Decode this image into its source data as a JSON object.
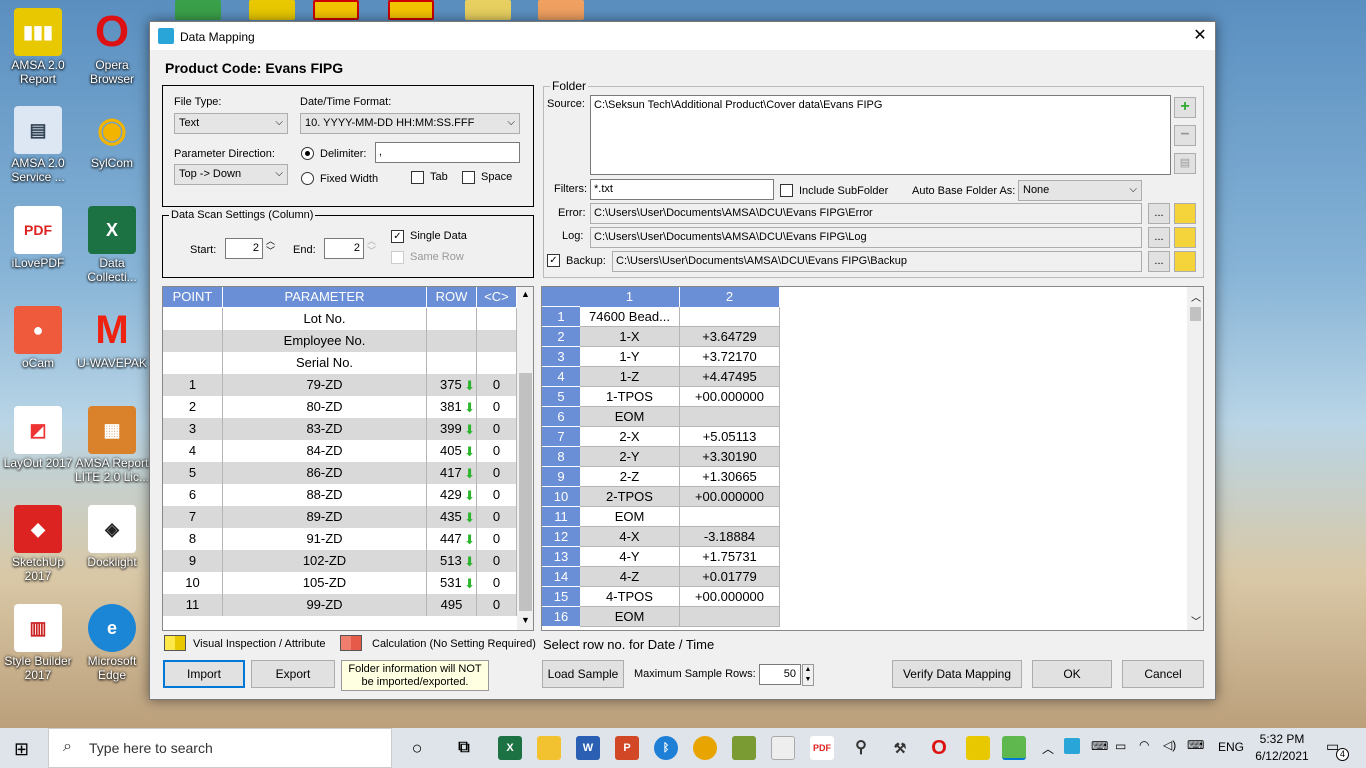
{
  "desktop": {
    "icons": [
      {
        "label": "AMSA 2.0 Report",
        "color": "#e8c800"
      },
      {
        "label": "Opera Browser",
        "color": "#d11"
      },
      {
        "label": "AMSA 2.0 Service ...",
        "color": "#6b8fc9"
      },
      {
        "label": "SylCom",
        "color": "#f3b400"
      },
      {
        "label": "iLovePDF",
        "color": "#fff"
      },
      {
        "label": "Data Collecti...",
        "color": "#1d7244"
      },
      {
        "label": "oCam",
        "color": "#ee5a3b"
      },
      {
        "label": "U-WAVEPAK",
        "color": "#e21"
      },
      {
        "label": "LayOut 2017",
        "color": "#e33"
      },
      {
        "label": "AMSA Report LITE 2.0 Lic...",
        "color": "#d9822b"
      },
      {
        "label": "SketchUp 2017",
        "color": "#d22"
      },
      {
        "label": "Docklight",
        "color": "#222"
      },
      {
        "label": "Style Builder 2017",
        "color": "#c22"
      },
      {
        "label": "Microsoft Edge",
        "color": "#1c86d6"
      }
    ]
  },
  "window": {
    "title": "Data Mapping",
    "close_glyph": "✕",
    "product_code": "Product Code: Evans FIPG"
  },
  "file_settings": {
    "file_type_label": "File Type:",
    "file_type_value": "Text",
    "datetime_label": "Date/Time Format:",
    "datetime_value": "10. YYYY-MM-DD HH:MM:SS.FFF",
    "param_dir_label": "Parameter Direction:",
    "param_dir_value": "Top -> Down",
    "delimiter_label": "Delimiter:",
    "delimiter_value": ",",
    "fixed_width_label": "Fixed Width",
    "tab_label": "Tab",
    "space_label": "Space"
  },
  "scan": {
    "legend": "Data Scan Settings (Column)",
    "start_label": "Start:",
    "start_value": "2",
    "end_label": "End:",
    "end_value": "2",
    "single_data_label": "Single Data",
    "same_row_label": "Same Row"
  },
  "folder": {
    "legend": "Folder",
    "source_label": "Source:",
    "source_value": "C:\\Seksun Tech\\Additional Product\\Cover data\\Evans FIPG",
    "filters_label": "Filters:",
    "filters_value": "*.txt",
    "include_sub_label": "Include SubFolder",
    "auto_base_label": "Auto Base Folder As:",
    "auto_base_value": "None",
    "error_label": "Error:",
    "error_value": "C:\\Users\\User\\Documents\\AMSA\\DCU\\Evans FIPG\\Error",
    "log_label": "Log:",
    "log_value": "C:\\Users\\User\\Documents\\AMSA\\DCU\\Evans FIPG\\Log",
    "backup_label": "Backup:",
    "backup_value": "C:\\Users\\User\\Documents\\AMSA\\DCU\\Evans FIPG\\Backup",
    "browse_label": "..."
  },
  "param_table": {
    "headers": [
      "POINT",
      "PARAMETER",
      "ROW",
      "<C>"
    ],
    "rows": [
      {
        "point": "",
        "parameter": "Lot No.",
        "row": "",
        "c": "",
        "arrow": false
      },
      {
        "point": "",
        "parameter": "Employee No.",
        "row": "",
        "c": "",
        "arrow": false
      },
      {
        "point": "",
        "parameter": "Serial No.",
        "row": "",
        "c": "",
        "arrow": false
      },
      {
        "point": "1",
        "parameter": "79-ZD",
        "row": "375",
        "c": "0",
        "arrow": true
      },
      {
        "point": "2",
        "parameter": "80-ZD",
        "row": "381",
        "c": "0",
        "arrow": true
      },
      {
        "point": "3",
        "parameter": "83-ZD",
        "row": "399",
        "c": "0",
        "arrow": true
      },
      {
        "point": "4",
        "parameter": "84-ZD",
        "row": "405",
        "c": "0",
        "arrow": true
      },
      {
        "point": "5",
        "parameter": "86-ZD",
        "row": "417",
        "c": "0",
        "arrow": true
      },
      {
        "point": "6",
        "parameter": "88-ZD",
        "row": "429",
        "c": "0",
        "arrow": true
      },
      {
        "point": "7",
        "parameter": "89-ZD",
        "row": "435",
        "c": "0",
        "arrow": true
      },
      {
        "point": "8",
        "parameter": "91-ZD",
        "row": "447",
        "c": "0",
        "arrow": true
      },
      {
        "point": "9",
        "parameter": "102-ZD",
        "row": "513",
        "c": "0",
        "arrow": true
      },
      {
        "point": "10",
        "parameter": "105-ZD",
        "row": "531",
        "c": "0",
        "arrow": true
      },
      {
        "point": "11",
        "parameter": "99-ZD",
        "row": "495",
        "c": "0",
        "arrow": false
      }
    ]
  },
  "sample_grid": {
    "col_headers": [
      "1",
      "2"
    ],
    "rows": [
      {
        "n": "1",
        "c1": "74600  Bead...",
        "c2": ""
      },
      {
        "n": "2",
        "c1": "1-X",
        "c2": "+3.64729"
      },
      {
        "n": "3",
        "c1": "1-Y",
        "c2": "+3.72170"
      },
      {
        "n": "4",
        "c1": "1-Z",
        "c2": "+4.47495"
      },
      {
        "n": "5",
        "c1": "1-TPOS",
        "c2": "+00.000000"
      },
      {
        "n": "6",
        "c1": "EOM",
        "c2": ""
      },
      {
        "n": "7",
        "c1": "2-X",
        "c2": "+5.05113"
      },
      {
        "n": "8",
        "c1": "2-Y",
        "c2": "+3.30190"
      },
      {
        "n": "9",
        "c1": "2-Z",
        "c2": "+1.30665"
      },
      {
        "n": "10",
        "c1": "2-TPOS",
        "c2": "+00.000000"
      },
      {
        "n": "11",
        "c1": "EOM",
        "c2": ""
      },
      {
        "n": "12",
        "c1": "4-X",
        "c2": "-3.18884"
      },
      {
        "n": "13",
        "c1": "4-Y",
        "c2": "+1.75731"
      },
      {
        "n": "14",
        "c1": "4-Z",
        "c2": "+0.01779"
      },
      {
        "n": "15",
        "c1": "4-TPOS",
        "c2": "+00.000000"
      },
      {
        "n": "16",
        "c1": "EOM",
        "c2": ""
      }
    ]
  },
  "legend": {
    "visual_label": "Visual Inspection / Attribute",
    "visual_color": "#ffe84a",
    "calc_label": "Calculation (No Setting Required)",
    "calc_color": "#f07e6e",
    "hint": "Select row no. for Date / Time"
  },
  "buttons": {
    "import": "Import",
    "export": "Export",
    "note": "Folder information will NOT be imported/exported.",
    "load_sample": "Load Sample",
    "max_rows_label": "Maximum Sample Rows:",
    "max_rows_value": "50",
    "verify": "Verify Data Mapping",
    "ok": "OK",
    "cancel": "Cancel"
  },
  "taskbar": {
    "search_placeholder": "Type here to search",
    "lang": "ENG",
    "time": "5:32 PM",
    "date": "6/12/2021",
    "notif_count": "4"
  },
  "colors": {
    "header_blue": "#6a8fd6",
    "row_gray": "#d9d9d9",
    "arrow_green": "#2db52d"
  }
}
